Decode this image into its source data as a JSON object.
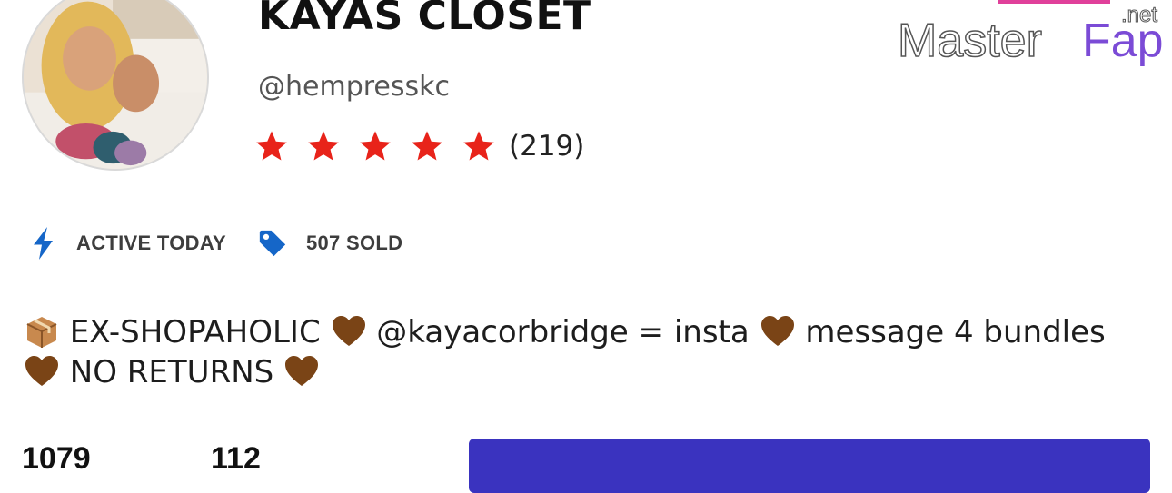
{
  "profile": {
    "shop_name": "KAYAS CLOSET",
    "handle": "@hempresskc",
    "rating": {
      "stars": 5,
      "max_stars": 5,
      "review_count": "(219)",
      "star_color": "#e8231a"
    }
  },
  "meta": {
    "active": {
      "icon": "lightning-icon",
      "label": "ACTIVE TODAY"
    },
    "sold": {
      "icon": "price-tag-icon",
      "label": "507 SOLD"
    },
    "icon_color": "#1566c8"
  },
  "bio": {
    "icon_package": "package-emoji",
    "icon_heart": "brown-heart-emoji",
    "part1": " EX-SHOPAHOLIC ",
    "part2": " @kayacorbridge = insta ",
    "part3": " message 4 bundles ",
    "part4": " NO RETURNS "
  },
  "stats": {
    "first_value": "1079",
    "second_value": "112"
  },
  "primary_button": {
    "color": "#3a33bf"
  },
  "watermark": {
    "text_left": "Master",
    "text_right": "Fap",
    "suffix": ".net"
  }
}
